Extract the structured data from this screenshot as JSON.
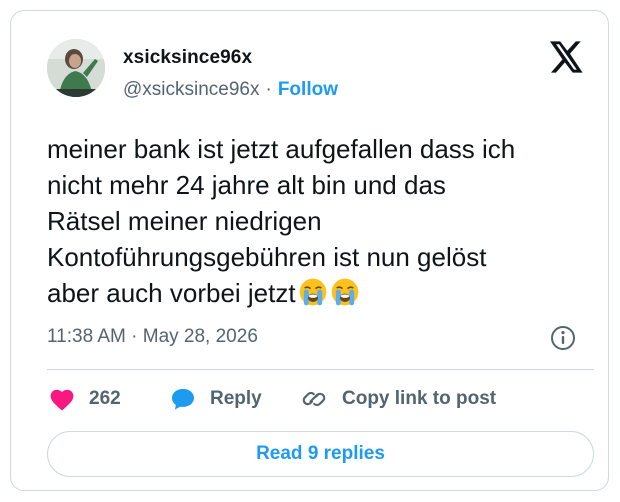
{
  "author": {
    "display_name": "xsicksince96x",
    "handle": "@xsicksince96x",
    "separator": "·",
    "follow_label": "Follow"
  },
  "tweet": {
    "text": "meiner bank ist jetzt aufgefallen dass ich\nnicht mehr 24 jahre alt bin und das\nRätsel meiner niedrigen\nKontoführungsgebühren ist nun gelöst\naber auch vorbei jetzt",
    "emojis": [
      "loudly-crying-face",
      "loudly-crying-face"
    ],
    "timestamp": "11:38 AM · May 28, 2026"
  },
  "actions": {
    "like_count": "262",
    "reply_label": "Reply",
    "copy_label": "Copy link to post"
  },
  "read_replies_label": "Read 9 replies",
  "colors": {
    "accent": "#1d9bf0",
    "like": "#f91880",
    "text": "#0f1419",
    "muted": "#536471",
    "border": "#cfd9de"
  },
  "icons": {
    "brand": "x-logo-icon",
    "info": "info-icon",
    "like": "heart-icon",
    "reply": "speech-bubble-icon",
    "copy": "link-icon"
  }
}
